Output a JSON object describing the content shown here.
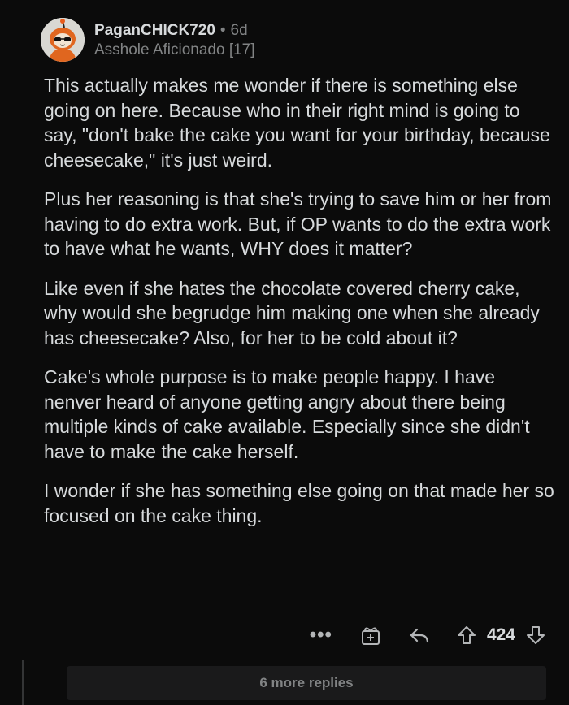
{
  "comment": {
    "username": "PaganCHICK720",
    "separator": "•",
    "age": "6d",
    "flair": "Asshole Aficionado [17]",
    "paragraphs": [
      "This actually makes me wonder if there is something else going on here. Because who in their right mind is going to say, \"don't bake the cake you want for your birthday, because cheesecake,\" it's just weird.",
      "Plus her reasoning is that she's trying to save him or her from having to do extra work. But, if OP wants to do the extra work to have what he wants, WHY does it matter?",
      "Like even if she hates the chocolate covered cherry cake, why would she begrudge him making one when she already has cheesecake? Also, for her to be cold about it?",
      "Cake's whole purpose is to make people happy. I have nenver heard of anyone getting angry about there being multiple kinds of cake available. Especially since she didn't have to make the cake herself.",
      "I wonder if she has something else going on that made her so focused on the cake thing."
    ]
  },
  "actions": {
    "more_label": "•••",
    "score": "424",
    "icons": [
      "more-icon",
      "award-icon",
      "reply-icon",
      "upvote-icon",
      "downvote-icon"
    ]
  },
  "more_replies": {
    "label": "6 more replies"
  },
  "colors": {
    "background": "#0b0b0b",
    "text": "#d7dadc",
    "muted": "#818384",
    "panel": "#1a1a1b"
  }
}
